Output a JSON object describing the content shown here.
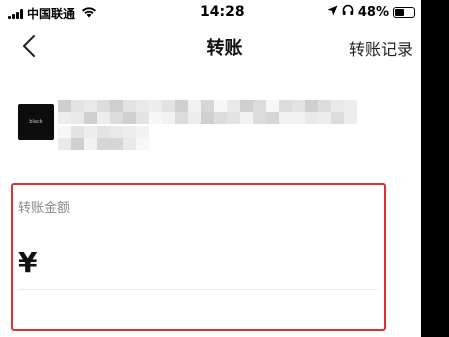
{
  "status_bar": {
    "carrier": "中国联通",
    "time": "14:28",
    "battery": "48%",
    "battery_level": 0.48,
    "icons": [
      "signal-icon",
      "wifi-icon",
      "location-arrow-icon",
      "headphones-icon",
      "battery-icon"
    ]
  },
  "nav": {
    "back_icon": "chevron-left-icon",
    "title": "转账",
    "right_link": "转账记录"
  },
  "recipient": {
    "avatar_text": "black",
    "name_redacted": true
  },
  "amount": {
    "label": "转账金额",
    "currency": "¥",
    "value": "",
    "highlight_color": "#e03030"
  }
}
